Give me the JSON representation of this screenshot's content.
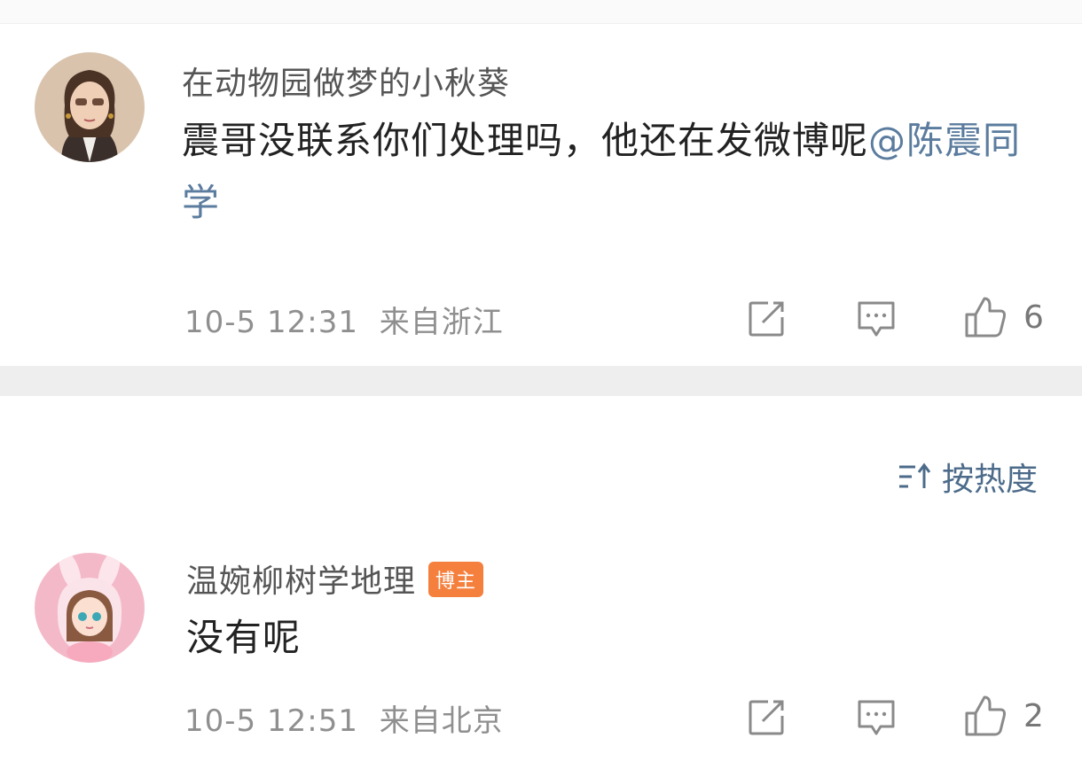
{
  "comments": [
    {
      "username": "在动物园做梦的小秋葵",
      "text": "震哥没联系你们处理吗，他还在发微博呢",
      "mention": "@陈震同学",
      "time": "10-5 12:31",
      "location": "来自浙江",
      "likes": "6"
    },
    {
      "username": "温婉柳树学地理",
      "badge": "博主",
      "text": "没有呢",
      "time": "10-5 12:51",
      "location": "来自北京",
      "likes": "2"
    }
  ],
  "sort": {
    "label": "按热度"
  },
  "icons": {
    "share": "share-icon",
    "comment": "comment-icon",
    "like": "thumbs-up-icon",
    "sort": "sort-icon"
  },
  "colors": {
    "mention": "#5b7c9e",
    "badge": "#f5803e",
    "sort": "#4c6b8a"
  }
}
